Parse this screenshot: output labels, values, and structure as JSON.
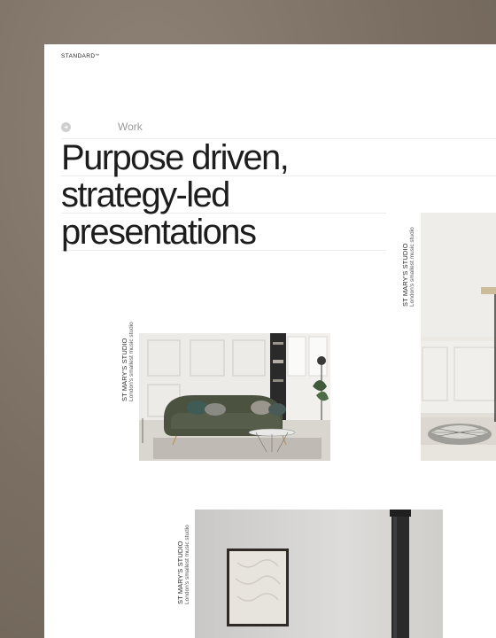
{
  "brand": {
    "name": "STANDARD",
    "mark": "™"
  },
  "breadcrumb": {
    "label": "Work"
  },
  "headline": {
    "lines": [
      "Purpose driven,",
      "strategy-led",
      "presentations"
    ]
  },
  "projects": [
    {
      "title": "ST MARY'S STUDIO",
      "subtitle": "London's smallest music studio"
    },
    {
      "title": "ST MARY'S STUDIO",
      "subtitle": "London's smallest music studio"
    },
    {
      "title": "ST MARY'S STUDIO",
      "subtitle": "London's smallest music studio"
    }
  ],
  "colors": {
    "backdrop": "#7a6e62",
    "sheet": "#ffffff",
    "text": "#1d1d1d",
    "sofa": "#4b5240"
  }
}
